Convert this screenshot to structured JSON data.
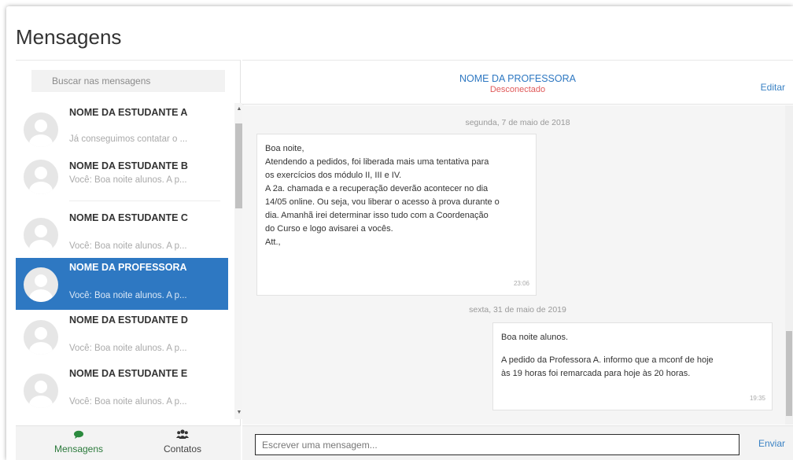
{
  "page": {
    "title": "Mensagens"
  },
  "sidebar": {
    "search_placeholder": "Buscar nas mensagens",
    "contacts": [
      {
        "name": "NOME DA ESTUDANTE A",
        "preview": "Já conseguimos contatar o ...",
        "active": false
      },
      {
        "name": "NOME DA ESTUDANTE B",
        "preview": "Você: Boa noite alunos. A p...",
        "active": false
      },
      {
        "name": "NOME DA ESTUDANTE C",
        "preview": "Você: Boa noite alunos. A p...",
        "active": false
      },
      {
        "name": "NOME DA PROFESSORA",
        "preview": "Você: Boa noite alunos. A p...",
        "active": true
      },
      {
        "name": "NOME DA ESTUDANTE D",
        "preview": "Você: Boa noite alunos. A p...",
        "active": false
      },
      {
        "name": "NOME DA ESTUDANTE E",
        "preview": "Você: Boa noite alunos. A p...",
        "active": false
      }
    ],
    "footer_tabs": [
      {
        "label": "Mensagens",
        "icon": "speech-bubble-icon",
        "selected": true
      },
      {
        "label": "Contatos",
        "icon": "users-icon",
        "selected": false
      }
    ]
  },
  "chat": {
    "contact_name": "NOME DA PROFESSORA",
    "status": "Desconectado",
    "edit_label": "Editar",
    "days": [
      {
        "label": "segunda, 7 de maio de 2018",
        "messages": [
          {
            "lines": [
              "Boa noite,",
              "Atendendo a pedidos, foi liberada mais uma tentativa para",
              "os exercícios dos módulo II, III e IV.",
              "A 2a. chamada e a recuperação deverão acontecer no dia",
              "14/05 online. Ou seja, vou liberar o acesso à prova durante o",
              "dia. Amanhã irei determinar isso tudo com a Coordenação",
              "do Curso e logo avisarei a vocês.",
              "Att.,"
            ],
            "time": "23:06"
          }
        ]
      },
      {
        "label": "sexta, 31 de maio de 2019",
        "messages": [
          {
            "lines": [
              "Boa noite alunos.",
              "",
              "A pedido da Professora A. informo que a mconf de hoje",
              "às 19 horas foi remarcada para hoje às 20 horas."
            ],
            "time": "19:35"
          }
        ]
      }
    ],
    "input_placeholder": "Escrever uma mensagem...",
    "send_label": "Enviar"
  }
}
